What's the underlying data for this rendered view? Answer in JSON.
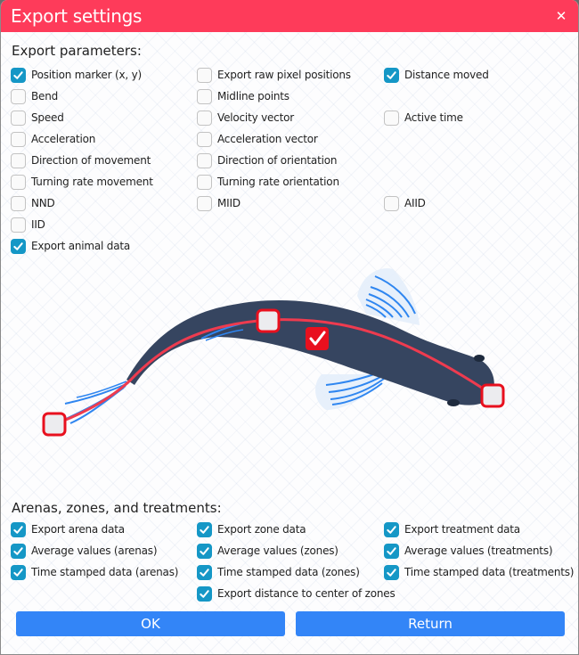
{
  "window": {
    "title": "Export settings",
    "close_icon": "close-icon",
    "accent_color": "#fe3b5a",
    "checkbox_color": "#1597c6",
    "button_color": "#3385f7"
  },
  "export_parameters": {
    "heading": "Export parameters:",
    "items": [
      {
        "label": "Position marker (x, y)",
        "checked": true
      },
      {
        "label": "Export raw pixel positions",
        "checked": false
      },
      {
        "label": "Distance moved",
        "checked": true
      },
      {
        "label": "Bend",
        "checked": false
      },
      {
        "label": "Midline points",
        "checked": false
      },
      {
        "label": "Speed",
        "checked": false
      },
      {
        "label": "Velocity vector",
        "checked": false
      },
      {
        "label": "Active time",
        "checked": false
      },
      {
        "label": "Acceleration",
        "checked": false
      },
      {
        "label": "Acceleration vector",
        "checked": false
      },
      {
        "label": "Direction of movement",
        "checked": false
      },
      {
        "label": "Direction of orientation",
        "checked": false
      },
      {
        "label": "Turning rate movement",
        "checked": false
      },
      {
        "label": "Turning rate orientation",
        "checked": false
      },
      {
        "label": "NND",
        "checked": false
      },
      {
        "label": "MIID",
        "checked": false
      },
      {
        "label": "AIID",
        "checked": false
      },
      {
        "label": "IID",
        "checked": false
      },
      {
        "label": "Export animal data",
        "checked": true
      }
    ]
  },
  "illustration": {
    "name": "fish-midline-illustration",
    "midline_marker_checked": true
  },
  "arenas_zones_treatments": {
    "heading": "Arenas, zones, and treatments:",
    "items": [
      {
        "label": "Export arena data",
        "checked": true
      },
      {
        "label": "Export zone data",
        "checked": true
      },
      {
        "label": "Export treatment data",
        "checked": true
      },
      {
        "label": "Average values (arenas)",
        "checked": true
      },
      {
        "label": "Average values (zones)",
        "checked": true
      },
      {
        "label": "Average values (treatments)",
        "checked": true
      },
      {
        "label": "Time stamped data (arenas)",
        "checked": true
      },
      {
        "label": "Time stamped data (zones)",
        "checked": true
      },
      {
        "label": "Time stamped data (treatments)",
        "checked": true
      },
      {
        "label": "Export distance to center of zones",
        "checked": true
      }
    ]
  },
  "buttons": {
    "ok": "OK",
    "return": "Return"
  }
}
